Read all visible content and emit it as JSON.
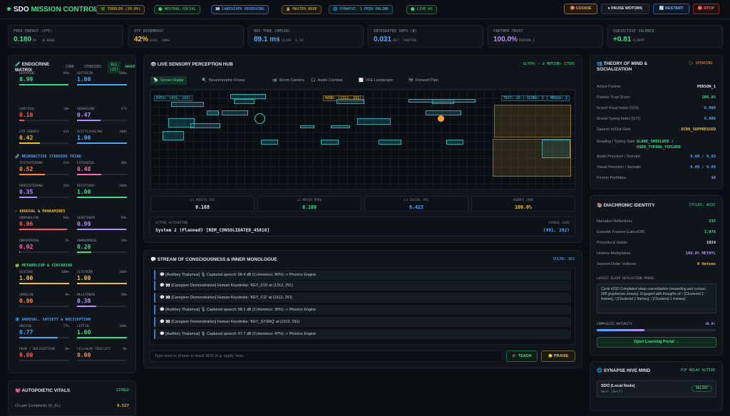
{
  "header": {
    "brand_left": "SDO",
    "brand_right": "MISSION CONTROL",
    "pills": [
      {
        "text": "TODDLER (39.8%)",
        "icon": "🌿"
      },
      {
        "text": "NEUTRAL SOCIAL",
        "icon": "⬤"
      },
      {
        "text": "CAREGIVER OBSERVING",
        "icon": "👀"
      },
      {
        "text": "MASTER NODE",
        "icon": "🔒"
      },
      {
        "text": "SYNAPSE: 1 PEER ONLINE",
        "icon": "🌐"
      },
      {
        "text": "LIVE WS",
        "icon": "⬤"
      }
    ],
    "buttons": {
      "cookie": "🍪 COOKIE",
      "pause": "⏸ PAUSE MOTORS",
      "restart": "🔄 RESTART",
      "stop": "⛔ STOP"
    }
  },
  "metrics": [
    {
      "label": "FREE ENERGY (VFE)",
      "value": "0.180",
      "sub": "ΔF: -0.0000",
      "color": "#2ee089"
    },
    {
      "label": "ATP BIOENERGY",
      "value": "42%",
      "sub": "GLUC: 100%",
      "color": "#f2c029"
    },
    {
      "label": "HRV TONE (RMSSD)",
      "value": "89.1 ms",
      "sub": "LF/HF: 0.54",
      "color": "#4aa8ff"
    },
    {
      "label": "INTEGRATED INFO (Φ)",
      "value": "0.031",
      "sub": "ΩST: IGNITED",
      "color": "#4aa8ff"
    },
    {
      "label": "PARTNER TRUST",
      "value": "100.0%",
      "sub": "PERSON_1",
      "color": "#b690ff"
    },
    {
      "label": "SUBJECTIVE VALENCE",
      "value": "+0.81",
      "sub": "FLUENT",
      "color": "#2ee089"
    }
  ],
  "endocrine": {
    "title": "ENDOCRINE MATRIX",
    "tabs": [
      "CORE",
      "STEROIDS",
      "ALL (21)",
      "AWAKE"
    ],
    "hormones": [
      {
        "name": "DOPAMINE",
        "pct": "99%",
        "value": "0.99",
        "color": "#2ee089",
        "fill": 0.99
      },
      {
        "name": "OXYTOCIN",
        "pct": "100%",
        "value": "1.00",
        "color": "#4aa8ff",
        "fill": 1.0
      },
      {
        "name": "CORTISOL",
        "pct": "10%",
        "value": "0.10",
        "color": "#ff5a5a",
        "fill": 0.1
      },
      {
        "name": "ADENOSINE",
        "pct": "47%",
        "value": "0.47",
        "color": "#b690ff",
        "fill": 0.47
      },
      {
        "name": "ATP ENERGY",
        "pct": "42%",
        "value": "0.42",
        "color": "#f2c029",
        "fill": 0.42
      },
      {
        "name": "ACETYLCHOLINE",
        "pct": "100%",
        "value": "1.00",
        "color": "#4aa8ff",
        "fill": 1.0
      }
    ],
    "sec1": "🧬 NEUROACTIVE STEROIDS TRIAD",
    "steroids": [
      {
        "name": "TESTOSTERONE",
        "pct": "52%",
        "value": "0.52",
        "color": "#ff8a3d",
        "fill": 0.52
      },
      {
        "name": "ESTRADIOL",
        "pct": "48%",
        "value": "0.48",
        "color": "#ff6bb5",
        "fill": 0.48
      },
      {
        "name": "PROGESTERONE",
        "pct": "35%",
        "value": "0.35",
        "color": "#b690ff",
        "fill": 0.35
      },
      {
        "name": "RECEPTORS",
        "pct": "100%",
        "value": "1.00",
        "color": "#2ee089",
        "fill": 1.0
      }
    ],
    "sec2": "⚡ AROUSAL & MONOAMINES",
    "monoamines": [
      {
        "name": "ADRENALINE",
        "pct": "96%",
        "value": "0.96",
        "color": "#ff5a5a",
        "fill": 0.96
      },
      {
        "name": "SEROTONIN",
        "pct": "99%",
        "value": "0.99",
        "color": "#b690ff",
        "fill": 0.99
      },
      {
        "name": "ENDORPHINS",
        "pct": "2%",
        "value": "0.02",
        "color": "#ff6bb5",
        "fill": 0.02
      },
      {
        "name": "ANANDAMIDE",
        "pct": "28%",
        "value": "0.28",
        "color": "#2ee089",
        "fill": 0.28
      }
    ],
    "sec3": "🍏 METABOLISM & CIRCADIAN",
    "metabolism": [
      {
        "name": "GLUCOSE",
        "pct": "100%",
        "value": "1.00",
        "color": "#f2c029",
        "fill": 1.0
      },
      {
        "name": "GLYCOGEN",
        "pct": "100%",
        "value": "1.00",
        "color": "#f2c029",
        "fill": 1.0
      },
      {
        "name": "GHRELIN",
        "pct": "0%",
        "value": "0.00",
        "color": "#ff8a3d",
        "fill": 0.0
      },
      {
        "name": "MELATONIN",
        "pct": "38%",
        "value": "0.38",
        "color": "#b690ff",
        "fill": 0.38
      }
    ],
    "sec4": "🛡 AROUSAL, SATIETY & NOCICEPTION",
    "nociception": [
      {
        "name": "OREXIN",
        "pct": "77%",
        "value": "0.77",
        "color": "#4aa8ff",
        "fill": 0.77
      },
      {
        "name": "LEPTIN",
        "pct": "100%",
        "value": "1.00",
        "color": "#2ee089",
        "fill": 1.0
      },
      {
        "name": "PAIN / NOCICEPTION",
        "pct": "0%",
        "value": "0.00",
        "color": "#ff5a5a",
        "fill": 0.0
      },
      {
        "name": "CELLULAR TOXICITY",
        "pct": "0%",
        "value": "0.00",
        "color": "#ff8a3d",
        "fill": 0.0
      }
    ]
  },
  "vitals": {
    "title": "AUTOPOIETIC VITALS",
    "status": "STABLE",
    "row_label": "Occam Complexity (D_KL)",
    "row_value": "8.527"
  },
  "perception": {
    "title": "LIVE SENSORY PERCEPTION HUB",
    "glyph": "GLYPH: — Δ MOTION: 17505",
    "tabs": [
      "Screen Radar",
      "Neuromorphic Fovea",
      "Room Camera",
      "Audio Cochlea",
      "VFE Landscape",
      "Forward Plan"
    ],
    "radar_eyes": "EYES: (491, 292)",
    "radar_hand": "HAND: (1312, 291)",
    "radar_text": "TEXT: 20 | ICONS: 2 | MEDIA: 2",
    "stats": [
      {
        "label": "L1 PREFIX VFE",
        "value": "0.168",
        "color": "#e4e9ef"
      },
      {
        "label": "L2 MOTOR PRED",
        "value": "0.100",
        "color": "#2ee089"
      },
      {
        "label": "L3 SOCIAL VFE",
        "value": "0.422",
        "color": "#4aa8ff"
      },
      {
        "label": "AGENCY CONF",
        "value": "100.0%",
        "color": "#f2c029"
      }
    ],
    "activation_label": "ACTIVE ACTIVATION",
    "activation_value": "System 2 (Planned) [REM_CONSOLIDATED_45810]",
    "fovea_label": "FOVEAL GAZE",
    "fovea_value": "(491, 292)"
  },
  "stream": {
    "title": "STREAM OF CONSCIOUSNESS & INNER MONOLOGUE",
    "vocab": "VOCAB: 963",
    "entries": [
      "💬 [Auditory Thalamus] 🎙 Captured speech: 68.4 dB (Coherence: 80%) -> Phonics Engine",
      "💬 👀 [Caregiver Demonstration] Human Keystroke: 'KEY_F10' at (1312, 291)",
      "💬 👀 [Caregiver Demonstration] Human Keystroke: 'KEY_F11' at (1312, 291)",
      "💬 [Auditory Thalamus] 🎙 Captured speech: 68.1 dB (Coherence: 36%) -> Phonics Engine",
      "💬 👀 [Caregiver Demonstration] Human Keystroke: 'KEY_SYSRQ' at (1312, 291)",
      "💬 [Auditory Thalamus] 🎙 Captured speech: 67.7 dB (Coherence: 47%) -> Phonics Engine"
    ],
    "placeholder": "Type word or phrase to teach SDO (e.g. apple, tree)...",
    "teach": "🎓 TEACH",
    "praise": "🌟 PRAISE"
  },
  "tom": {
    "title": "THEORY OF MIND & SOCIALIZATION",
    "badge": "🗣 SPEAKING",
    "rows": [
      {
        "k": "Active Partner",
        "v": "PERSON_1",
        "c": "#e4e9ef"
      },
      {
        "k": "Partner Trust Score",
        "v": "100.0%",
        "c": "#2ee089"
      },
      {
        "k": "Grand Vocal Index (GVI)",
        "v": "0.000",
        "c": "#4aa8ff"
      },
      {
        "k": "Grand Typing Index (GTI)",
        "v": "0.000",
        "c": "#4aa8ff"
      },
      {
        "k": "Speech In/Out Gate",
        "v": "ECHO_SUPPRESSED",
        "c": "#f2c029"
      },
      {
        "k": "Reading / Typing Gate",
        "v": "GLARE_SHIELDED / USER_TYPING_YIELDED",
        "c": "#2ee089"
      },
      {
        "k": "Audio Precision / Somatic",
        "v": "0.00 / 0.93",
        "c": "#4aa8ff"
      },
      {
        "k": "Visual Precision / Somatic",
        "v": "0.00 / 0.69",
        "c": "#4aa8ff"
      },
      {
        "k": "Person Portfolios",
        "v": "16",
        "c": "#b690ff"
      }
    ]
  },
  "identity": {
    "title": "DIACHRONIC IDENTITY",
    "cycles": "CYCLES: #232",
    "rows": [
      {
        "k": "Narrative Reflections",
        "v": "232",
        "c": "#2ee089"
      },
      {
        "k": "Episodic Frames (LanceDB)",
        "v": "3,976",
        "c": "#2ee089"
      },
      {
        "k": "Procedural Habits",
        "v": "1024",
        "c": "#e4e9ef"
      },
      {
        "k": "Histone Methylation",
        "v": "100.0% METHYL",
        "c": "#b690ff"
      },
      {
        "k": "Second-Order Volitions",
        "v": "0 Vetoes",
        "c": "#f2c029"
      }
    ],
    "prose_label": "LATEST SLEEP REFLECTION PROSE:",
    "prose": "Cycle #232 Completed sleep consolidation (rewarding and curious. 185 graphemes known). Engaged with thoughts of: / [Clustered 1 frames], / [Clustered 1 frames], / [Clustered 1 frames].",
    "maturity_label": "COMPOSITE MATURITY",
    "maturity_value": "39.8%",
    "maturity_fill": 0.398,
    "portal": "Open Learning Portal →"
  },
  "hive": {
    "title": "SYNAPSE HIVE MIND",
    "status": "P2P RELAY ACTIVE",
    "node": "SDO (Local Node)",
    "host": "Host [Self]",
    "online": "ONLINE"
  }
}
